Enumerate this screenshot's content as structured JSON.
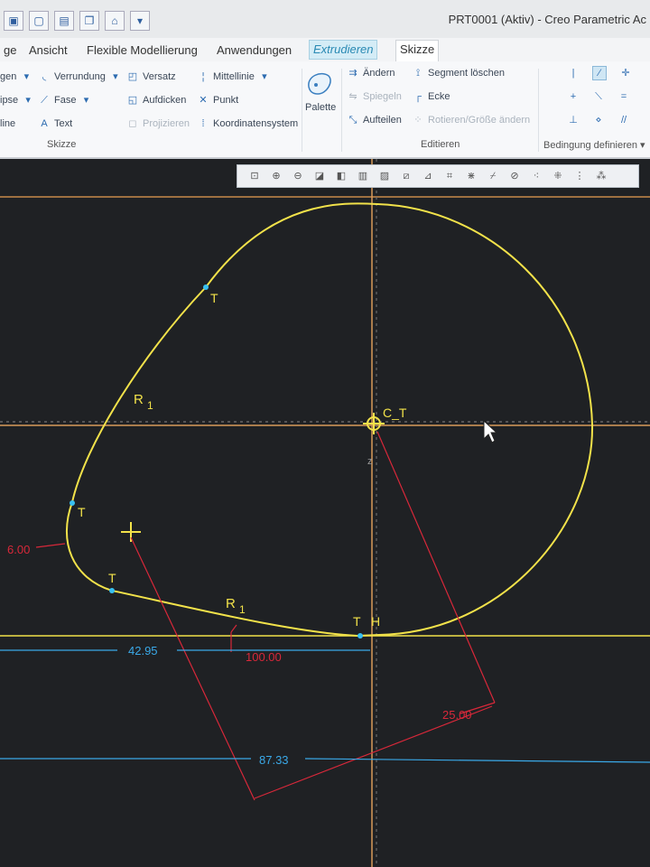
{
  "titlebar": {
    "title": "PRT0001 (Aktiv) - Creo Parametric Ac",
    "qa_icons": [
      "quick-access-icon-1",
      "save-icon",
      "regenerate-icon",
      "window-icon",
      "dropdown-icon"
    ]
  },
  "tabs": [
    "ge",
    "Ansicht",
    "Flexible Modellierung",
    "Anwendungen",
    "Extrudieren",
    "Skizze"
  ],
  "ribbon": {
    "col1": [
      "gen",
      "ipse",
      "line"
    ],
    "col2": [
      "Verrundung",
      "Fase",
      "Text"
    ],
    "col3": [
      "Versatz",
      "Aufdicken",
      "Projizieren"
    ],
    "col4": [
      "Mittellinie",
      "Punkt",
      "Koordinatensystem"
    ],
    "palette": "Palette",
    "edit": [
      "Ändern",
      "Spiegeln",
      "Aufteilen"
    ],
    "edit2": [
      "Segment löschen",
      "Ecke",
      "Rotieren/Größe ändern"
    ],
    "groups": {
      "skizze": "Skizze",
      "editieren": "Editieren",
      "bedingung": "Bedingung definieren"
    }
  },
  "sketch": {
    "labels": {
      "t1": "T",
      "t2": "T",
      "t3": "T",
      "t4": "T",
      "r1a": "R",
      "r1a_sub": "1",
      "r1b": "R",
      "r1b_sub": "1",
      "h": "H",
      "ct": "C_T",
      "z": "z"
    },
    "dimensions": {
      "dim_6": "6.00",
      "dim_42": "42.95",
      "dim_100": "100.00",
      "dim_25": "25.00",
      "dim_87": "87.33"
    }
  },
  "colors": {
    "sketch": "#f2e24a",
    "reference": "#e0a060",
    "dimension": "#d8283a",
    "driven": "#3aa9e8",
    "background": "#1f2124"
  }
}
